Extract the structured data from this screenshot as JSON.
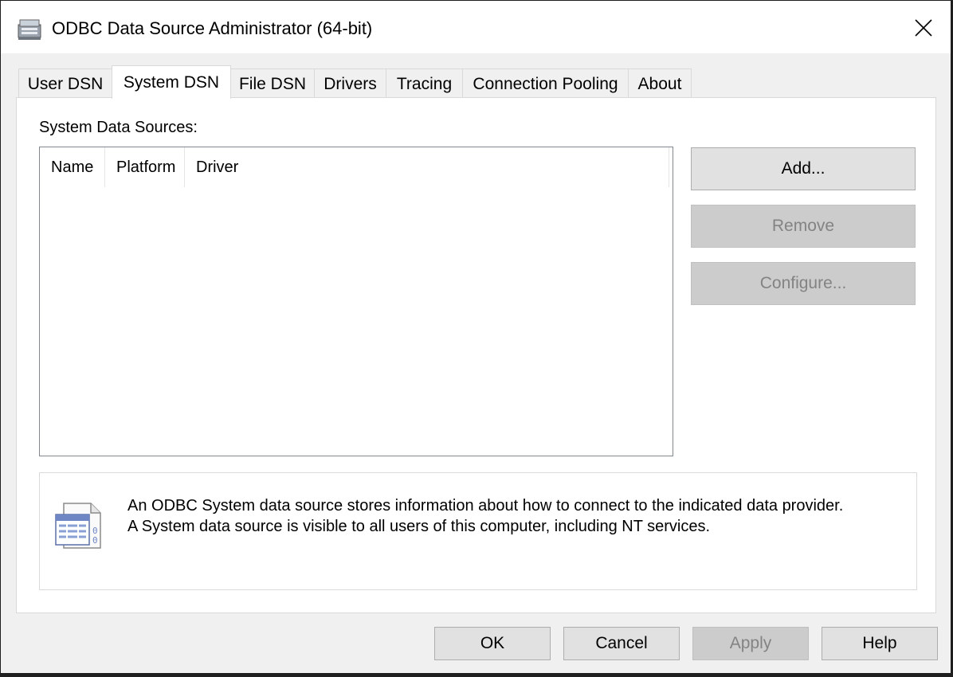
{
  "window": {
    "title": "ODBC Data Source Administrator (64-bit)",
    "app_icon": "odbc-admin-icon",
    "close_icon": "close-icon"
  },
  "tabs": [
    {
      "label": "User DSN",
      "active": false
    },
    {
      "label": "System DSN",
      "active": true
    },
    {
      "label": "File DSN",
      "active": false
    },
    {
      "label": "Drivers",
      "active": false
    },
    {
      "label": "Tracing",
      "active": false
    },
    {
      "label": "Connection Pooling",
      "active": false
    },
    {
      "label": "About",
      "active": false
    }
  ],
  "system_dsn": {
    "section_label": "System Data Sources:",
    "columns": [
      "Name",
      "Platform",
      "Driver"
    ],
    "rows": [],
    "buttons": {
      "add": {
        "label": "Add...",
        "enabled": true
      },
      "remove": {
        "label": "Remove",
        "enabled": false
      },
      "configure": {
        "label": "Configure...",
        "enabled": false
      }
    },
    "info": {
      "icon": "data-source-icon",
      "line1": "An ODBC System data source stores information about how to connect to the indicated data provider.",
      "line2": "A System data source is visible to all users of this computer, including NT services."
    }
  },
  "footer": {
    "ok": {
      "label": "OK",
      "enabled": true
    },
    "cancel": {
      "label": "Cancel",
      "enabled": true
    },
    "apply": {
      "label": "Apply",
      "enabled": false
    },
    "help": {
      "label": "Help",
      "enabled": true
    }
  }
}
